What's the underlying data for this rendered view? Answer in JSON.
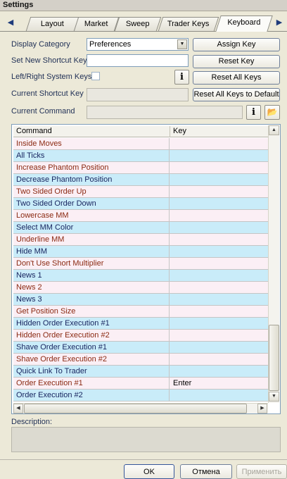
{
  "window": {
    "title": "Settings"
  },
  "tabs": [
    "Layout",
    "Market",
    "Sweep",
    "Trader Keys",
    "Keyboard"
  ],
  "active_tab": "Keyboard",
  "tab_arrows": {
    "left": "◀",
    "right": "▶"
  },
  "form": {
    "display_category_label": "Display Category",
    "display_category_value": "Preferences",
    "set_shortcut_label": "Set New Shortcut Key",
    "set_shortcut_value": "",
    "system_keys_label": "Left/Right System Keys",
    "system_keys_checked": false,
    "current_shortcut_label": "Current Shortcut Key",
    "current_shortcut_value": "",
    "current_command_label": "Current Command",
    "current_command_value": ""
  },
  "buttons": {
    "assign_key": "Assign Key",
    "reset_key": "Reset Key",
    "reset_all_keys": "Reset All Keys",
    "reset_all_default": "Reset All Keys to Default",
    "info_glyph": "i",
    "folder_glyph": "📂"
  },
  "grid": {
    "columns": [
      "Command",
      "Key"
    ],
    "rows": [
      {
        "command": "Inside Moves",
        "key": ""
      },
      {
        "command": "All Ticks",
        "key": ""
      },
      {
        "command": "Increase Phantom Position",
        "key": ""
      },
      {
        "command": "Decrease Phantom Position",
        "key": ""
      },
      {
        "command": "Two Sided Order Up",
        "key": ""
      },
      {
        "command": "Two Sided Order Down",
        "key": ""
      },
      {
        "command": "Lowercase MM",
        "key": ""
      },
      {
        "command": "Select MM Color",
        "key": ""
      },
      {
        "command": "Underline MM",
        "key": ""
      },
      {
        "command": "Hide MM",
        "key": ""
      },
      {
        "command": "Don't Use Short Multiplier",
        "key": ""
      },
      {
        "command": "News 1",
        "key": ""
      },
      {
        "command": "News 2",
        "key": ""
      },
      {
        "command": "News 3",
        "key": ""
      },
      {
        "command": "Get Position Size",
        "key": ""
      },
      {
        "command": "Hidden Order Execution #1",
        "key": ""
      },
      {
        "command": "Hidden Order Execution #2",
        "key": ""
      },
      {
        "command": "Shave Order Execution #1",
        "key": ""
      },
      {
        "command": "Shave Order Execution #2",
        "key": ""
      },
      {
        "command": "Quick Link To Trader",
        "key": ""
      },
      {
        "command": "Order Execution #1",
        "key": "Enter"
      },
      {
        "command": "Order Execution #2",
        "key": ""
      },
      {
        "command": "",
        "key": ""
      }
    ]
  },
  "scroll_arrows": {
    "up": "▲",
    "down": "▼",
    "left": "◀",
    "right": "▶"
  },
  "description": {
    "label": "Description:",
    "value": ""
  },
  "footer": {
    "ok": "OK",
    "cancel": "Отмена",
    "apply": "Применить"
  },
  "colors": {
    "row_pink": "#fbeff5",
    "row_blue": "#c9ecf9",
    "text_red": "#8b2a12",
    "text_navy": "#16235e"
  }
}
